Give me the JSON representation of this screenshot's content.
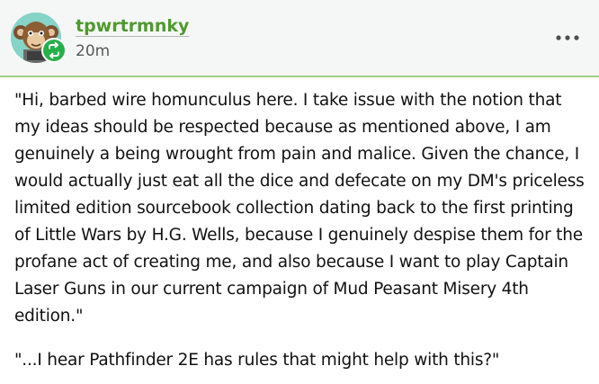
{
  "post": {
    "username": "tpwrtrmnky",
    "timestamp": "20m",
    "avatar_icon": "monkey-avatar",
    "badge_icon": "reblog-icon",
    "more_icon": "ellipsis-icon",
    "paragraphs": [
      "\"Hi, barbed wire homunculus here. I take issue with the notion that my ideas should be respected because as mentioned above, I am genuinely a being wrought from pain and malice. Given the chance, I would actually just eat all the dice and defecate on my DM's priceless limited edition sourcebook collection dating back to the first printing of Little Wars by H.G. Wells, because I genuinely despise them for the profane act of creating me, and also because I want to play Captain Laser Guns in our current campaign of Mud Peasant Misery 4th edition.\"",
      "\"...I hear Pathfinder 2E has rules that might help with this?\""
    ]
  },
  "colors": {
    "header_bg": "#f5f7f6",
    "accent_green": "#4e9a2e",
    "divider_green": "#9fd08a",
    "badge_green": "#26b04a",
    "text": "#111111",
    "muted": "#555c5a"
  }
}
